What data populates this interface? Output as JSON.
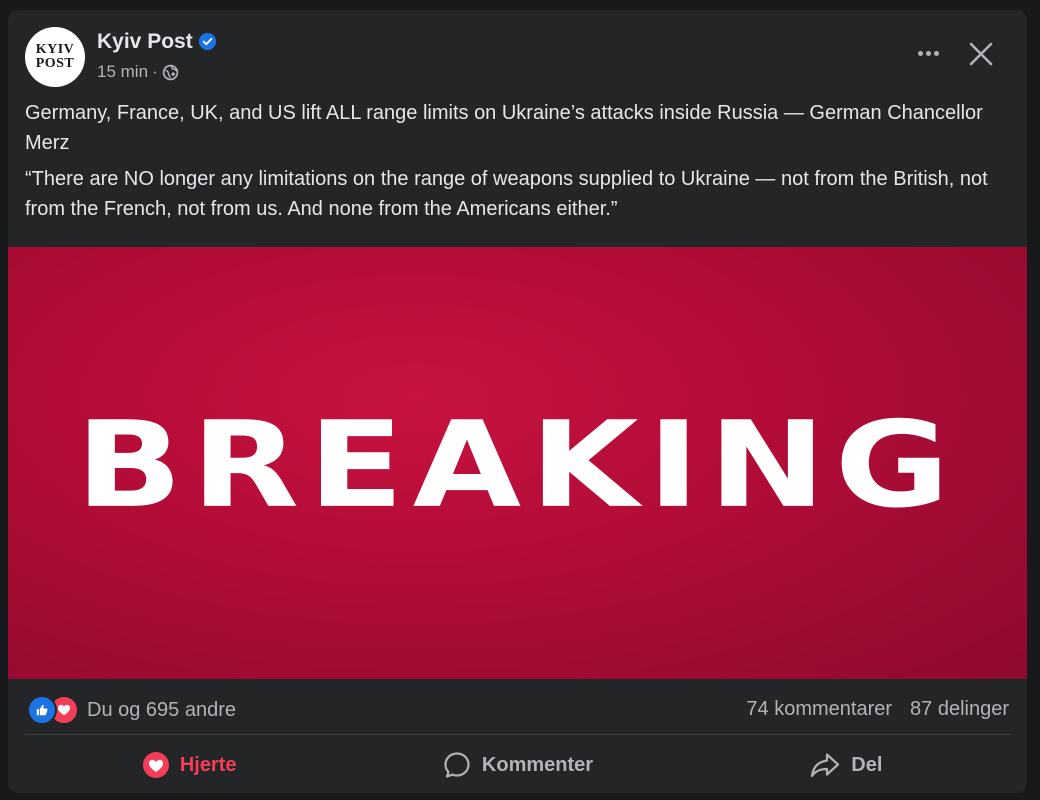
{
  "post": {
    "page_name": "Kyiv Post",
    "avatar": {
      "line1": "KYIV",
      "line2": "POST"
    },
    "time": "15 min",
    "separator": "·",
    "privacy_icon": "globe-icon",
    "verified_icon": "verified-badge-icon",
    "text": [
      "Germany, France, UK, and US lift ALL range limits on Ukraine’s attacks inside Russia — German Chancellor Merz",
      "“There are NO longer any limitations on the range of weapons supplied to Ukraine — not from the British, not from the French, not from us. And none from the Americans either.”"
    ],
    "image_text": "BREAKING"
  },
  "stats": {
    "reactions_text": "Du og 695 andre",
    "reaction_icons": [
      "like-icon",
      "love-icon"
    ],
    "comments": "74 kommentarer",
    "shares": "87 delinger"
  },
  "actions": {
    "love_label": "Hjerte",
    "comment_label": "Kommenter",
    "share_label": "Del"
  },
  "colors": {
    "background": "#18191a",
    "card": "#242526",
    "text_primary": "#e4e6eb",
    "text_secondary": "#b0b3b8",
    "verified_blue": "#1b74e4",
    "love_red": "#f33e58",
    "image_red": "#b00c36"
  }
}
